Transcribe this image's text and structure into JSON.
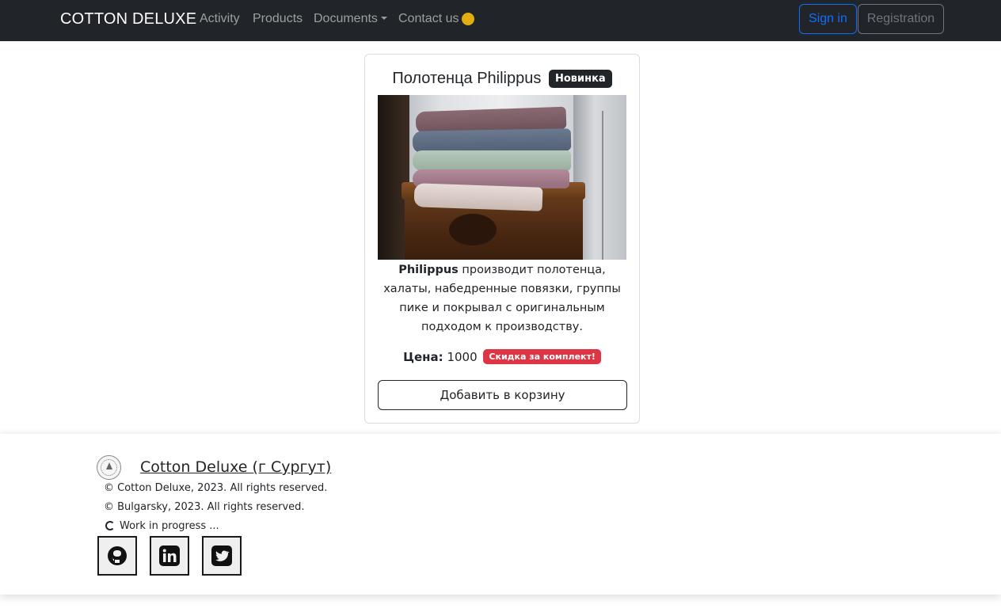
{
  "navbar": {
    "brand": "COTTON DELUXE",
    "links": [
      "Activity",
      "Products",
      "Documents",
      "Contact us"
    ],
    "status_color": "#e3ad0f",
    "sign_in": "Sign in",
    "registration": "Registration"
  },
  "product": {
    "title": "Полотенца Philippus",
    "badge": "Новинка",
    "image_icon": "towels-photo",
    "desc_brand": "Philippus",
    "desc_text": " производит полотенца, халаты, набедренные повязки, группы пике и покрывал с оригинальным подходом к производству.",
    "price_label": "Цена:",
    "price_value": "1000",
    "sale_badge": "Скидка за комплект!",
    "cart_button": "Добавить в корзину"
  },
  "footer": {
    "company_link": "Cotton Deluxe (г Сургут)",
    "copyright1": "© Cotton Deluxe, 2023. All rights reserved.",
    "copyright2": "© Bulgarsky, 2023. All rights reserved.",
    "status": "Work in progress ...",
    "social": [
      "github-icon",
      "linkedin-icon",
      "twitter-icon"
    ]
  },
  "colors": {
    "navbar_bg": "#212529",
    "primary": "#0d6efd",
    "secondary": "#6c757d",
    "danger": "#dc3545"
  }
}
